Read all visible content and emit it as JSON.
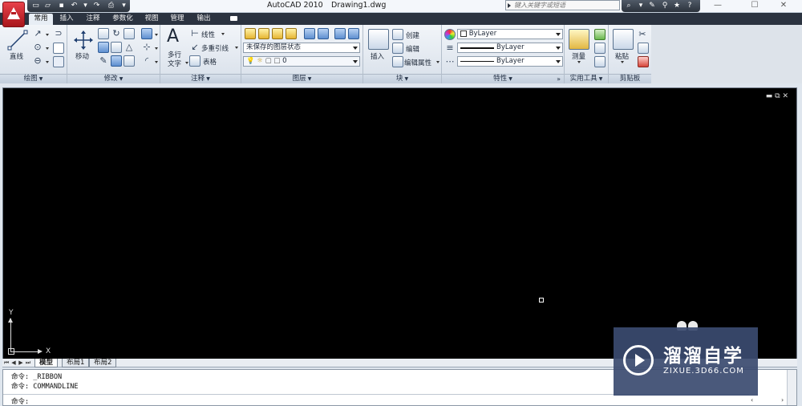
{
  "titlebar": {
    "app_name": "AutoCAD 2010",
    "document": "Drawing1.dwg",
    "search_placeholder": "键入关键字或短语",
    "minimize": "—",
    "maximize": "☐",
    "close": "✕"
  },
  "tabs": [
    "常用",
    "插入",
    "注释",
    "参数化",
    "视图",
    "管理",
    "输出"
  ],
  "panels": {
    "draw": {
      "title": "绘图",
      "line_label": "直线"
    },
    "modify": {
      "title": "修改",
      "move_label": "移动"
    },
    "annotation": {
      "title": "注释",
      "mtext_label_1": "多行",
      "mtext_label_2": "文字",
      "linear": "线性",
      "multileader": "多重引线",
      "table": "表格"
    },
    "layers": {
      "title": "图层",
      "layer_state": "未保存的图层状态",
      "current_layer": "0"
    },
    "block": {
      "title": "块",
      "insert": "插入",
      "create": "创建",
      "edit": "编辑",
      "edit_attributes": "编辑属性"
    },
    "properties": {
      "title": "特性",
      "color": "ByLayer",
      "linetype": "ByLayer",
      "lineweight": "ByLayer"
    },
    "utilities": {
      "title": "实用工具",
      "measure": "测量"
    },
    "clipboard": {
      "title": "剪贴板",
      "paste": "粘贴"
    }
  },
  "drawing": {
    "ucs_y": "Y",
    "ucs_x": "X"
  },
  "layout_tabs": [
    "模型",
    "布局1",
    "布局2"
  ],
  "command": {
    "history": [
      {
        "prompt": "命令:",
        "text": "_RIBBON"
      },
      {
        "prompt": "命令:",
        "text": "COMMANDLINE"
      }
    ],
    "prompt": "命令:",
    "input_value": ""
  },
  "watermark": {
    "title": "溜溜自学",
    "subtitle": "ZIXUE.3D66.COM"
  },
  "colors": {
    "tab_bar": "#2b3340",
    "canvas": "#000000",
    "ribbon": "#e8eef5",
    "watermark": "#3b4b70"
  }
}
